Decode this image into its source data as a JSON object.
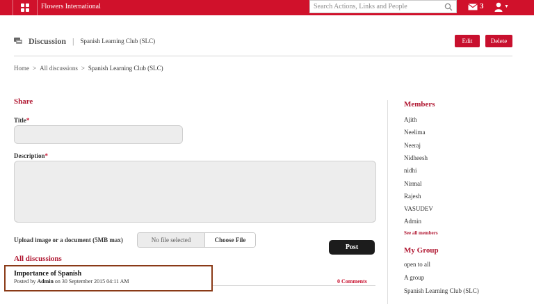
{
  "topbar": {
    "brand": "Flowers International",
    "search_placeholder": "Search Actions, Links and People",
    "message_count": "3",
    "apps_icon": "grid-icon",
    "mail_icon": "envelope-icon",
    "user_icon": "user-icon",
    "search_icon": "magnifier-icon",
    "color": "#d0112b"
  },
  "header": {
    "title": "Discussion",
    "separator": "|",
    "subtitle": "Spanish Learning Club (SLC)",
    "edit_label": "Edit",
    "delete_label": "Delete"
  },
  "breadcrumb": {
    "home": "Home",
    "all": "All discussions",
    "current": "Spanish Learning Club (SLC)",
    "sep": ">"
  },
  "form": {
    "heading": "Share",
    "title_label": "Title",
    "description_label": "Description",
    "required_mark": "*",
    "upload_label": "Upload image or a document (5MB max)",
    "file_status": "No file selected",
    "choose_label": "Choose File",
    "post_label": "Post"
  },
  "discussions": {
    "heading": "All discussions",
    "items": [
      {
        "title": "Importance of Spanish",
        "posted_by_prefix": "Posted by",
        "author": "Admin",
        "date_text": "on 30 September 2015 04:11 AM",
        "comments": "0 Comments"
      }
    ]
  },
  "sidebar": {
    "members_heading": "Members",
    "members": [
      "Ajith",
      "Neelima",
      "Neeraj",
      "Nidheesh",
      "nidhi",
      "Nirmal",
      "Rajesh",
      "VASUDEV",
      "Admin"
    ],
    "see_all": "See all members",
    "group_heading": "My Group",
    "groups": [
      "open to all",
      "A group",
      "Spanish Learning Club (SLC)"
    ]
  },
  "colors": {
    "accent": "#c8102e",
    "heading": "#b01630",
    "dark_button": "#1c1c1c"
  }
}
